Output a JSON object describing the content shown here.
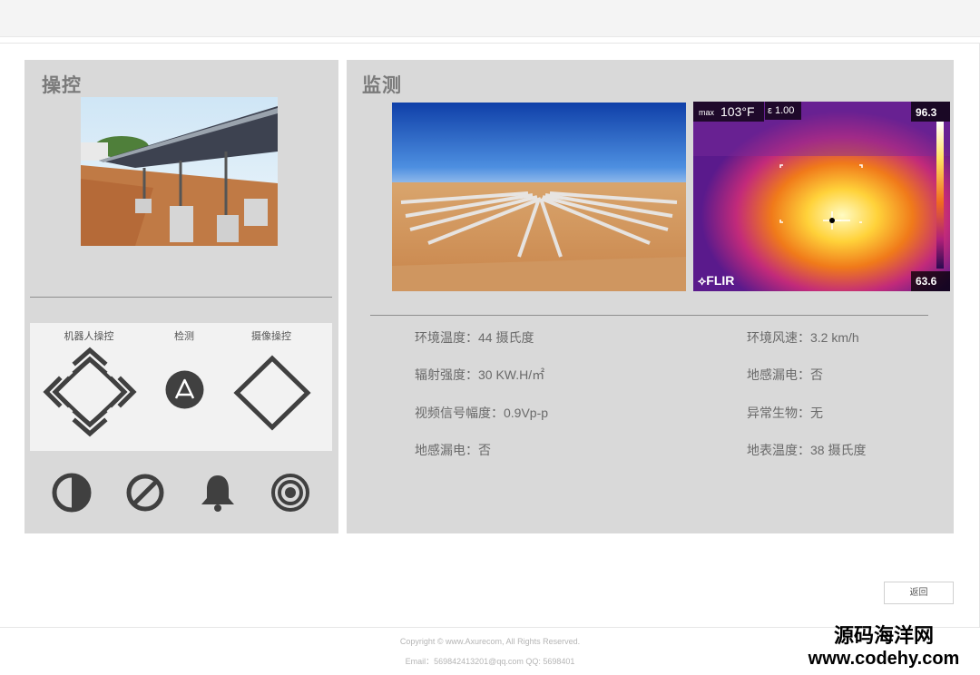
{
  "control": {
    "title": "操控",
    "labels": {
      "robot": "机器人操控",
      "detect": "检测",
      "camera": "摄像操控"
    },
    "bottom_icons": [
      "contrast-icon",
      "forbidden-icon",
      "bell-icon",
      "target-icon"
    ]
  },
  "monitor": {
    "title": "监测",
    "thermal": {
      "max_label": "max",
      "max_value": "103°F",
      "emissivity": "ε 1.00",
      "scale_top": "96.3",
      "scale_bottom": "63.6",
      "brand": "FLIR"
    },
    "info_left": [
      "环境温度：44 摄氏度",
      "辐射强度：30 KW.H/㎡",
      "视频信号幅度：0.9Vp-p",
      "地感漏电：否"
    ],
    "info_right": [
      "环境风速：3.2 km/h",
      "地感漏电：否",
      "异常生物：无",
      "地表温度：38 摄氏度"
    ]
  },
  "back_button": "返回",
  "footer": {
    "copyright": "Copyright © www.Axurecom, All Rights Reserved.",
    "contact": "Email：569842413201@qq.com   QQ: 5698401"
  },
  "watermark": {
    "line1": "源码海洋网",
    "line2": "www.codehy.com"
  },
  "colors": {
    "panel_bg": "#d9d9d9",
    "control_bg": "#f2f2f2",
    "icon_dark": "#404040"
  }
}
